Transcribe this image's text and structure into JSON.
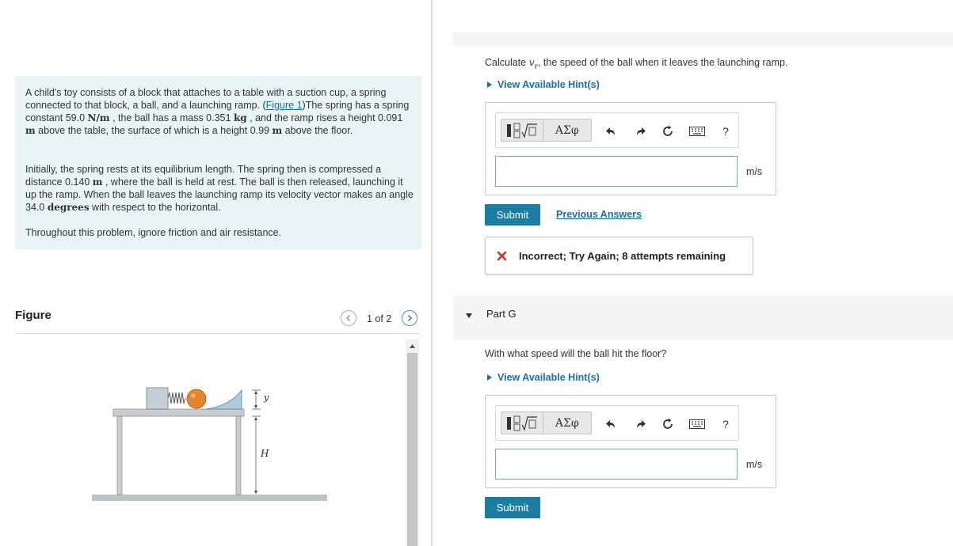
{
  "problem": {
    "p1_a": "A child's toy consists of a block that attaches to a table with a suction cup, a spring connected to that block, a ball, and a launching ramp. (",
    "p1_link": "Figure 1",
    "p1_b": ")The spring has a spring constant 59.0 ",
    "p1_unit1": "N/m",
    "p1_c": " , the ball has a mass 0.351 ",
    "p1_unit2": "kg",
    "p1_d": " , and the ramp rises a height 0.091 ",
    "p1_unit3": "m",
    "p1_e": " above the table, the surface of which is a height 0.99 ",
    "p1_unit4": "m",
    "p1_f": " above the floor.",
    "p2_a": "Initially, the spring rests at its equilibrium length. The spring then is compressed a distance 0.140 ",
    "p2_unit1": "m",
    "p2_b": " , where the ball is held at rest. The ball is then released, launching it up the ramp. When the ball leaves the launching ramp its velocity vector makes an angle 34.0 ",
    "p2_unit2": "degrees",
    "p2_c": " with respect to the horizontal.",
    "p3": "Throughout this problem, ignore friction and air resistance."
  },
  "figure": {
    "title": "Figure",
    "pager": "1 of 2",
    "label_y": "y",
    "label_H": "H"
  },
  "partF": {
    "question_a": "Calculate ",
    "question_var": "v",
    "question_sub": "r",
    "question_b": ", the speed of the ball when it leaves the launching ramp.",
    "hint": "View Available Hint(s)",
    "unit": "m/s",
    "submit": "Submit",
    "previous": "Previous Answers",
    "feedback": "Incorrect; Try Again; 8 attempts remaining"
  },
  "partG": {
    "title": "Part G",
    "question": "With what speed will the ball hit the floor?",
    "hint": "View Available Hint(s)",
    "unit": "m/s",
    "submit": "Submit"
  },
  "toolbar": {
    "greek": "ΑΣφ",
    "help": "?"
  },
  "colors": {
    "accent": "#1b7ea1",
    "link": "#1a6fa8",
    "problem_bg": "#e8f4f5",
    "error": "#c0392b"
  }
}
